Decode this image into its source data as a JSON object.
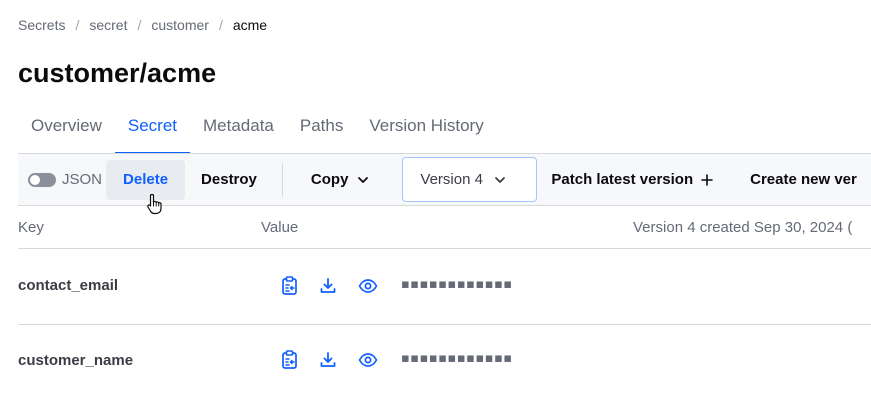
{
  "breadcrumb": {
    "items": [
      "Secrets",
      "secret",
      "customer"
    ],
    "separator": "/",
    "current": "acme"
  },
  "page_title": "customer/acme",
  "tabs": [
    {
      "label": "Overview",
      "active": false
    },
    {
      "label": "Secret",
      "active": true
    },
    {
      "label": "Metadata",
      "active": false
    },
    {
      "label": "Paths",
      "active": false
    },
    {
      "label": "Version History",
      "active": false
    }
  ],
  "toolbar": {
    "json_toggle_label": "JSON",
    "json_toggle_on": false,
    "delete_label": "Delete",
    "destroy_label": "Destroy",
    "copy_label": "Copy",
    "version_label": "Version 4",
    "patch_label": "Patch latest version",
    "create_label": "Create new ver"
  },
  "table": {
    "headers": {
      "key": "Key",
      "value": "Value",
      "version_info": "Version 4 created Sep 30, 2024 ("
    },
    "rows": [
      {
        "key": "contact_email",
        "masked_value": "▪▪▪▪▪▪▪▪▪▪▪▪"
      },
      {
        "key": "customer_name",
        "masked_value": "▪▪▪▪▪▪▪▪▪▪▪▪"
      }
    ]
  },
  "icons": {
    "copy": "clipboard-copy-icon",
    "download": "download-icon",
    "reveal": "eye-icon",
    "chevron": "chevron-down-icon",
    "plus": "plus-icon",
    "cursor": "hand-pointer-cursor"
  },
  "colors": {
    "accent": "#1060ff",
    "text_primary": "#0c0c0e",
    "text_muted": "#656a76",
    "border": "#d7d9dd",
    "toolbar_bg": "#f7f8fa"
  }
}
